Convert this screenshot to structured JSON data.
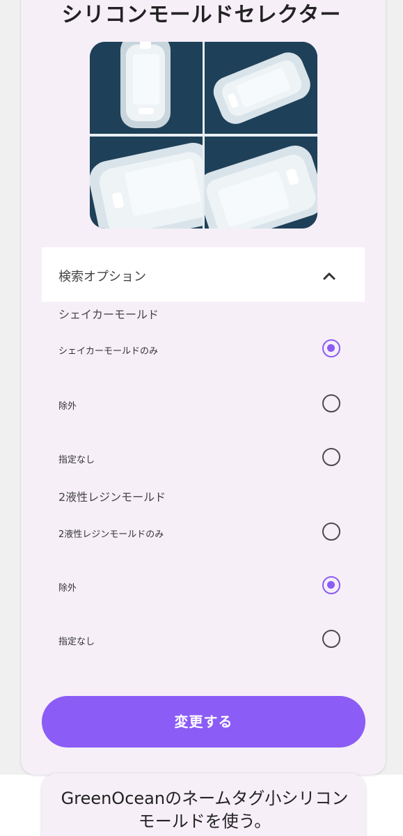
{
  "header": {
    "title": "シリコンモールドセレクター"
  },
  "search_options": {
    "header_label": "検索オプション",
    "chevron_icon": "chevron-up-icon",
    "groups": [
      {
        "title": "シェイカーモールド",
        "options": [
          {
            "label": "シェイカーモールドのみ",
            "checked": true
          },
          {
            "label": "除外",
            "checked": false
          },
          {
            "label": "指定なし",
            "checked": false
          }
        ]
      },
      {
        "title": "2液性レジンモールド",
        "options": [
          {
            "label": "2液性レジンモールドのみ",
            "checked": false
          },
          {
            "label": "除外",
            "checked": true
          },
          {
            "label": "指定なし",
            "checked": false
          }
        ]
      }
    ]
  },
  "actions": {
    "submit_label": "変更する"
  },
  "promo": {
    "text": "GreenOceanのネームタグ小シリコンモールドを使う。"
  },
  "colors": {
    "accent": "#8b5cf6",
    "card_background": "#f6eff8",
    "mold_background": "#1e4058"
  }
}
